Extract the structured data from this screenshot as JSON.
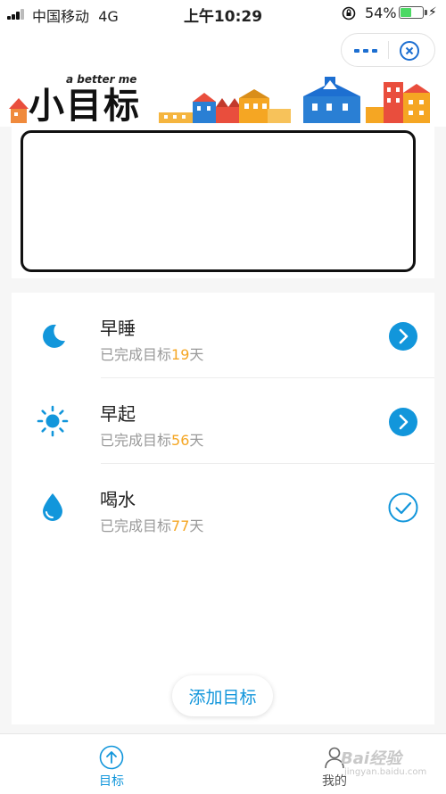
{
  "status_bar": {
    "carrier": "中国移动",
    "network": "4G",
    "time": "上午10:29",
    "battery_percent": "54%",
    "battery_level": 0.54
  },
  "header": {
    "logo_title": "小目标",
    "logo_subtitle": "a better me",
    "capsule": {
      "more_icon": "more-dots-icon",
      "close_icon": "miniapp-close-icon"
    }
  },
  "goals": [
    {
      "name": "早睡",
      "prefix": "已完成目标",
      "days": "19",
      "suffix": "天",
      "icon": "moon-icon",
      "action": "go-arrow"
    },
    {
      "name": "早起",
      "prefix": "已完成目标",
      "days": "56",
      "suffix": "天",
      "icon": "sun-icon",
      "action": "go-arrow"
    },
    {
      "name": "喝水",
      "prefix": "已完成目标",
      "days": "77",
      "suffix": "天",
      "icon": "water-drop-icon",
      "action": "completed-check"
    }
  ],
  "add_button_label": "添加目标",
  "tabbar": {
    "tabs": [
      {
        "label": "目标",
        "icon": "arrow-up-circle-icon",
        "active": true
      },
      {
        "label": "我的",
        "icon": "person-icon",
        "active": false
      }
    ]
  },
  "watermark": {
    "text": "Bai经验",
    "url_text": "jingyan.baidu.com"
  },
  "colors": {
    "accent": "#1296db",
    "days_highlight": "#f5a623",
    "subtext": "#999999",
    "battery_fill": "#4cd964"
  }
}
